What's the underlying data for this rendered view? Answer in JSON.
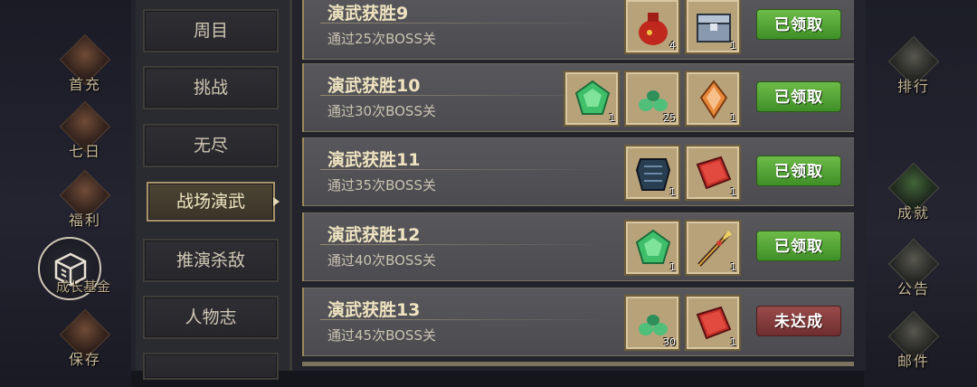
{
  "left_menu": [
    {
      "label": "首充",
      "icon": "gift-icon"
    },
    {
      "label": "七日",
      "icon": "scroll-icon"
    },
    {
      "label": "福利",
      "icon": "treasure-icon"
    },
    {
      "label": "成长基金",
      "icon": "cube-icon"
    },
    {
      "label": "保存",
      "icon": "scroll-save-icon"
    }
  ],
  "right_menu": [
    {
      "label": "排行",
      "icon": "ranking-plaque-icon"
    },
    {
      "label": "成就",
      "icon": "jade-icon"
    },
    {
      "label": "公告",
      "icon": "horn-icon"
    },
    {
      "label": "邮件",
      "icon": "envelope-icon"
    }
  ],
  "tabs": [
    {
      "label": "周目"
    },
    {
      "label": "挑战"
    },
    {
      "label": "无尽"
    },
    {
      "label": "战场演武",
      "active": true
    },
    {
      "label": "推演杀敌"
    },
    {
      "label": "人物志"
    }
  ],
  "rows": [
    {
      "title": "演武获胜9",
      "desc": "通过25次BOSS关",
      "status": "已领取",
      "items": [
        {
          "icon": "red-pouch-icon",
          "count": "4"
        },
        {
          "icon": "silver-chest-icon",
          "count": "1"
        }
      ]
    },
    {
      "title": "演武获胜10",
      "desc": "通过30次BOSS关",
      "status": "已领取",
      "items": [
        {
          "icon": "green-gem-icon",
          "count": "1"
        },
        {
          "icon": "jade-pendant-icon",
          "count": "25"
        },
        {
          "icon": "orange-crystal-icon",
          "count": "1"
        }
      ]
    },
    {
      "title": "演武获胜11",
      "desc": "通过35次BOSS关",
      "status": "已领取",
      "items": [
        {
          "icon": "dark-armor-icon",
          "count": "1"
        },
        {
          "icon": "red-book-icon",
          "count": "1"
        }
      ]
    },
    {
      "title": "演武获胜12",
      "desc": "通过40次BOSS关",
      "status": "已领取",
      "items": [
        {
          "icon": "green-gem-icon",
          "count": "1"
        },
        {
          "icon": "golden-spear-icon",
          "count": "1"
        }
      ]
    },
    {
      "title": "演武获胜13",
      "desc": "通过45次BOSS关",
      "status": "未达成",
      "items": [
        {
          "icon": "jade-pendant-icon",
          "count": "30"
        },
        {
          "icon": "red-book-icon",
          "count": "1"
        }
      ]
    }
  ],
  "colors": {
    "claimed": "#4f9f34",
    "not_met": "#8a3c3c",
    "gold_border": "#a89468"
  }
}
